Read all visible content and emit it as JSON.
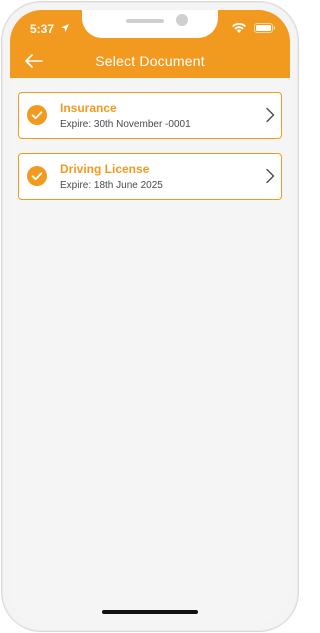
{
  "status_bar": {
    "time": "5:37",
    "location_icon": "location-arrow-icon",
    "wifi_icon": "wifi-icon",
    "battery_icon": "battery-icon"
  },
  "header": {
    "back_icon": "arrow-left-icon",
    "title": "Select Document"
  },
  "colors": {
    "accent": "#f29a1f",
    "background": "#f5f5f6",
    "card": "#ffffff",
    "text_secondary": "#4a4a4a"
  },
  "documents": [
    {
      "name": "Insurance",
      "expiry": "Expire: 30th November -0001",
      "selected": true,
      "icon": "check-circle-icon"
    },
    {
      "name": "Driving License",
      "expiry": "Expire: 18th June 2025",
      "selected": true,
      "icon": "check-circle-icon"
    }
  ]
}
